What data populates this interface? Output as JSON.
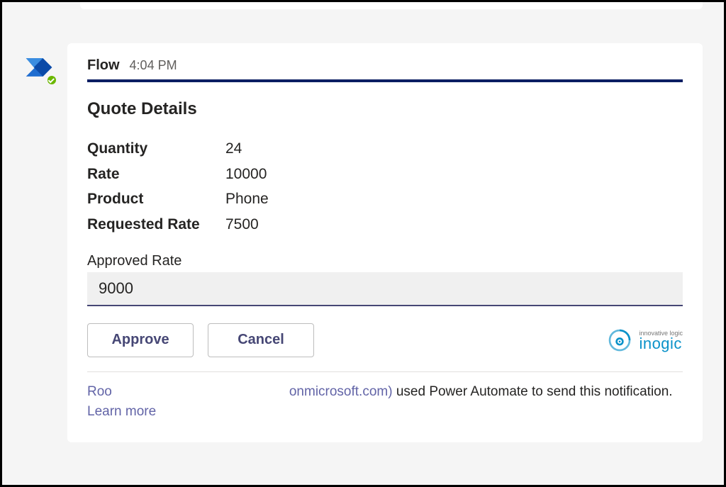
{
  "header": {
    "sender": "Flow",
    "timestamp": "4:04 PM"
  },
  "card": {
    "title": "Quote Details",
    "facts": [
      {
        "label": "Quantity",
        "value": "24"
      },
      {
        "label": "Rate",
        "value": "10000"
      },
      {
        "label": "Product",
        "value": "Phone"
      },
      {
        "label": "Requested Rate",
        "value": "7500"
      }
    ],
    "input": {
      "label": "Approved Rate",
      "value": "9000"
    },
    "actions": {
      "approve": "Approve",
      "cancel": "Cancel"
    }
  },
  "footer": {
    "name_prefix": "Roo",
    "domain_suffix": "onmicrosoft.com)",
    "mid_text": " used Power Automate to send this notification. ",
    "learn_more": "Learn more"
  },
  "watermark": {
    "brand": "inogic",
    "tagline": "innovative logic"
  },
  "colors": {
    "accent": "#464775",
    "card_top": "#0b1e63",
    "logo": "#0a92c9"
  }
}
